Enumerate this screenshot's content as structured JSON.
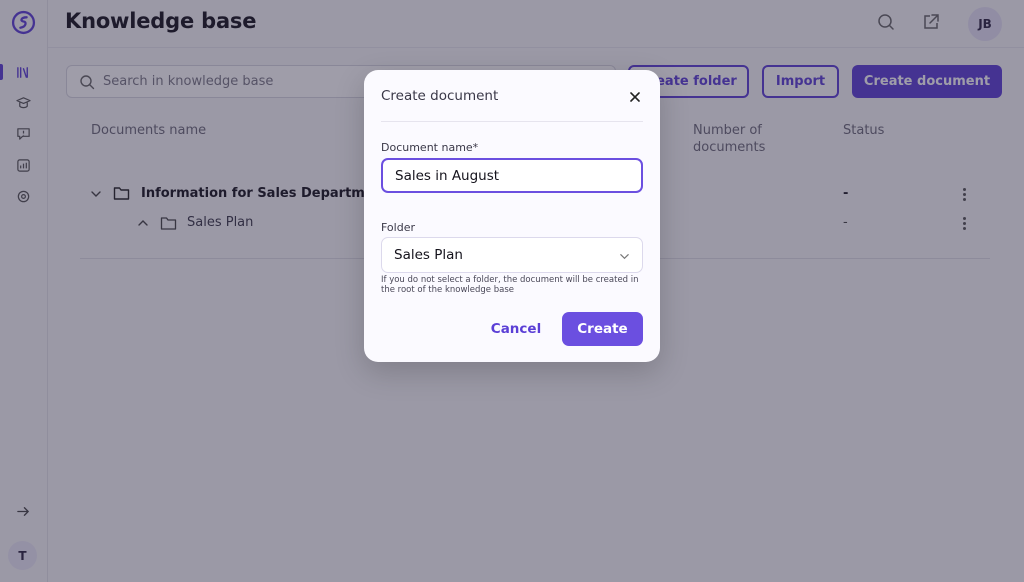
{
  "app": {
    "title": "Knowledge base",
    "brand_color": "#5b3fd6",
    "user_initials": "JB",
    "workspace_initial": "T"
  },
  "sidebar": {
    "items": [
      {
        "name": "knowledge-base",
        "icon": "books-icon",
        "active": true
      },
      {
        "name": "learning",
        "icon": "graduation-cap-icon"
      },
      {
        "name": "feedback",
        "icon": "chat-alert-icon"
      },
      {
        "name": "analytics",
        "icon": "chart-icon"
      },
      {
        "name": "settings",
        "icon": "gear-icon"
      }
    ],
    "expand_icon": "arrow-right-icon"
  },
  "header_icons": [
    "search-icon",
    "external-link-icon"
  ],
  "toolbar": {
    "search_placeholder": "Search in knowledge base",
    "create_folder_label": "Create folder",
    "import_label": "Import",
    "create_document_label": "Create document"
  },
  "table": {
    "columns": {
      "name": "Documents name",
      "number_line1": "Number of",
      "number_line2": "documents",
      "status": "Status"
    },
    "rows": [
      {
        "name": "Information for Sales Department",
        "status": "-",
        "expanded": true,
        "level": 0
      },
      {
        "name": "Sales Plan",
        "status": "-",
        "expanded": false,
        "level": 1
      }
    ]
  },
  "modal": {
    "title": "Create document",
    "name_label": "Document name*",
    "name_value": "Sales in August",
    "folder_label": "Folder",
    "folder_value": "Sales Plan",
    "helper_text": "If you do not select a folder, the document will be created in the root of the knowledge base",
    "cancel_label": "Cancel",
    "create_label": "Create"
  }
}
